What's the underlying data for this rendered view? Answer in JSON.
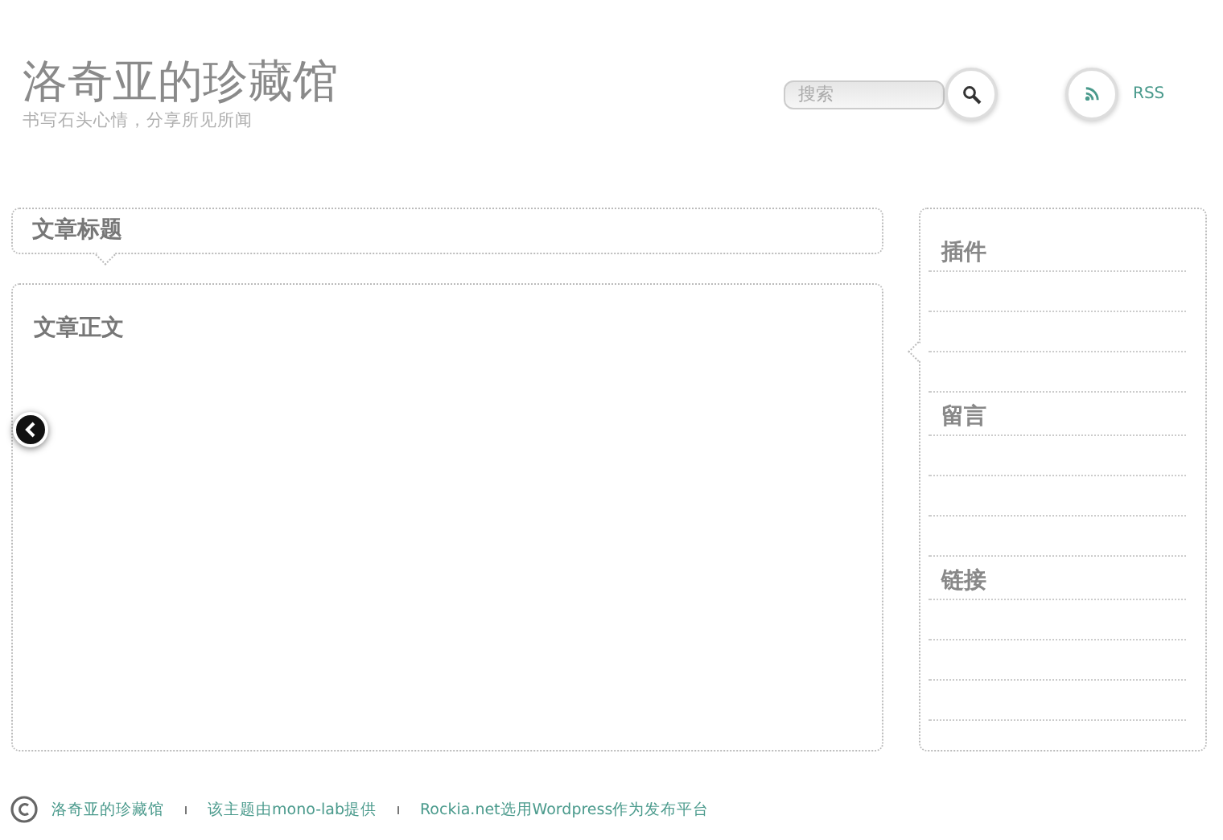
{
  "site": {
    "title": "洛奇亚的珍藏馆",
    "tagline": "书写石头心情，分享所见所闻"
  },
  "search": {
    "placeholder": "搜索"
  },
  "rss": {
    "label": "RSS"
  },
  "post": {
    "title": "文章标题",
    "body": "文章正文"
  },
  "sidebar": {
    "sections": [
      {
        "heading": "插件"
      },
      {
        "heading": "留言"
      },
      {
        "heading": "链接"
      }
    ]
  },
  "footer": {
    "links": [
      "洛奇亚的珍藏馆",
      "该主题由mono-lab提供",
      "Rockia.net选用Wordpress作为发布平台"
    ]
  }
}
